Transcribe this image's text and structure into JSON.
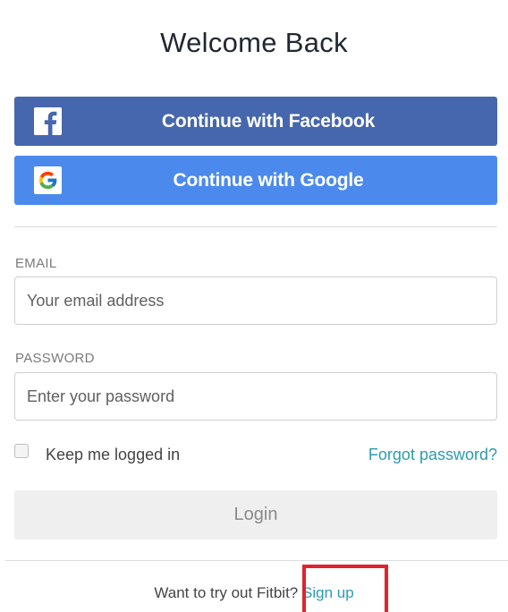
{
  "header": {
    "title": "Welcome Back"
  },
  "social": {
    "facebook": {
      "label": "Continue with Facebook",
      "icon": "facebook-icon",
      "color": "#4667ad"
    },
    "google": {
      "label": "Continue with Google",
      "icon": "google-icon",
      "color": "#4b8aec"
    }
  },
  "form": {
    "email": {
      "label": "EMAIL",
      "placeholder": "Your email address",
      "value": ""
    },
    "password": {
      "label": "PASSWORD",
      "placeholder": "Enter your password",
      "value": ""
    },
    "keep_logged_in": {
      "label": "Keep me logged in",
      "checked": false
    },
    "forgot_password": "Forgot password?",
    "login_label": "Login"
  },
  "footer": {
    "prompt": "Want to try out Fitbit?",
    "signup_label": "Sign up",
    "link_color": "#2c9bae"
  },
  "annotation": {
    "highlight_color": "#e0232d"
  }
}
